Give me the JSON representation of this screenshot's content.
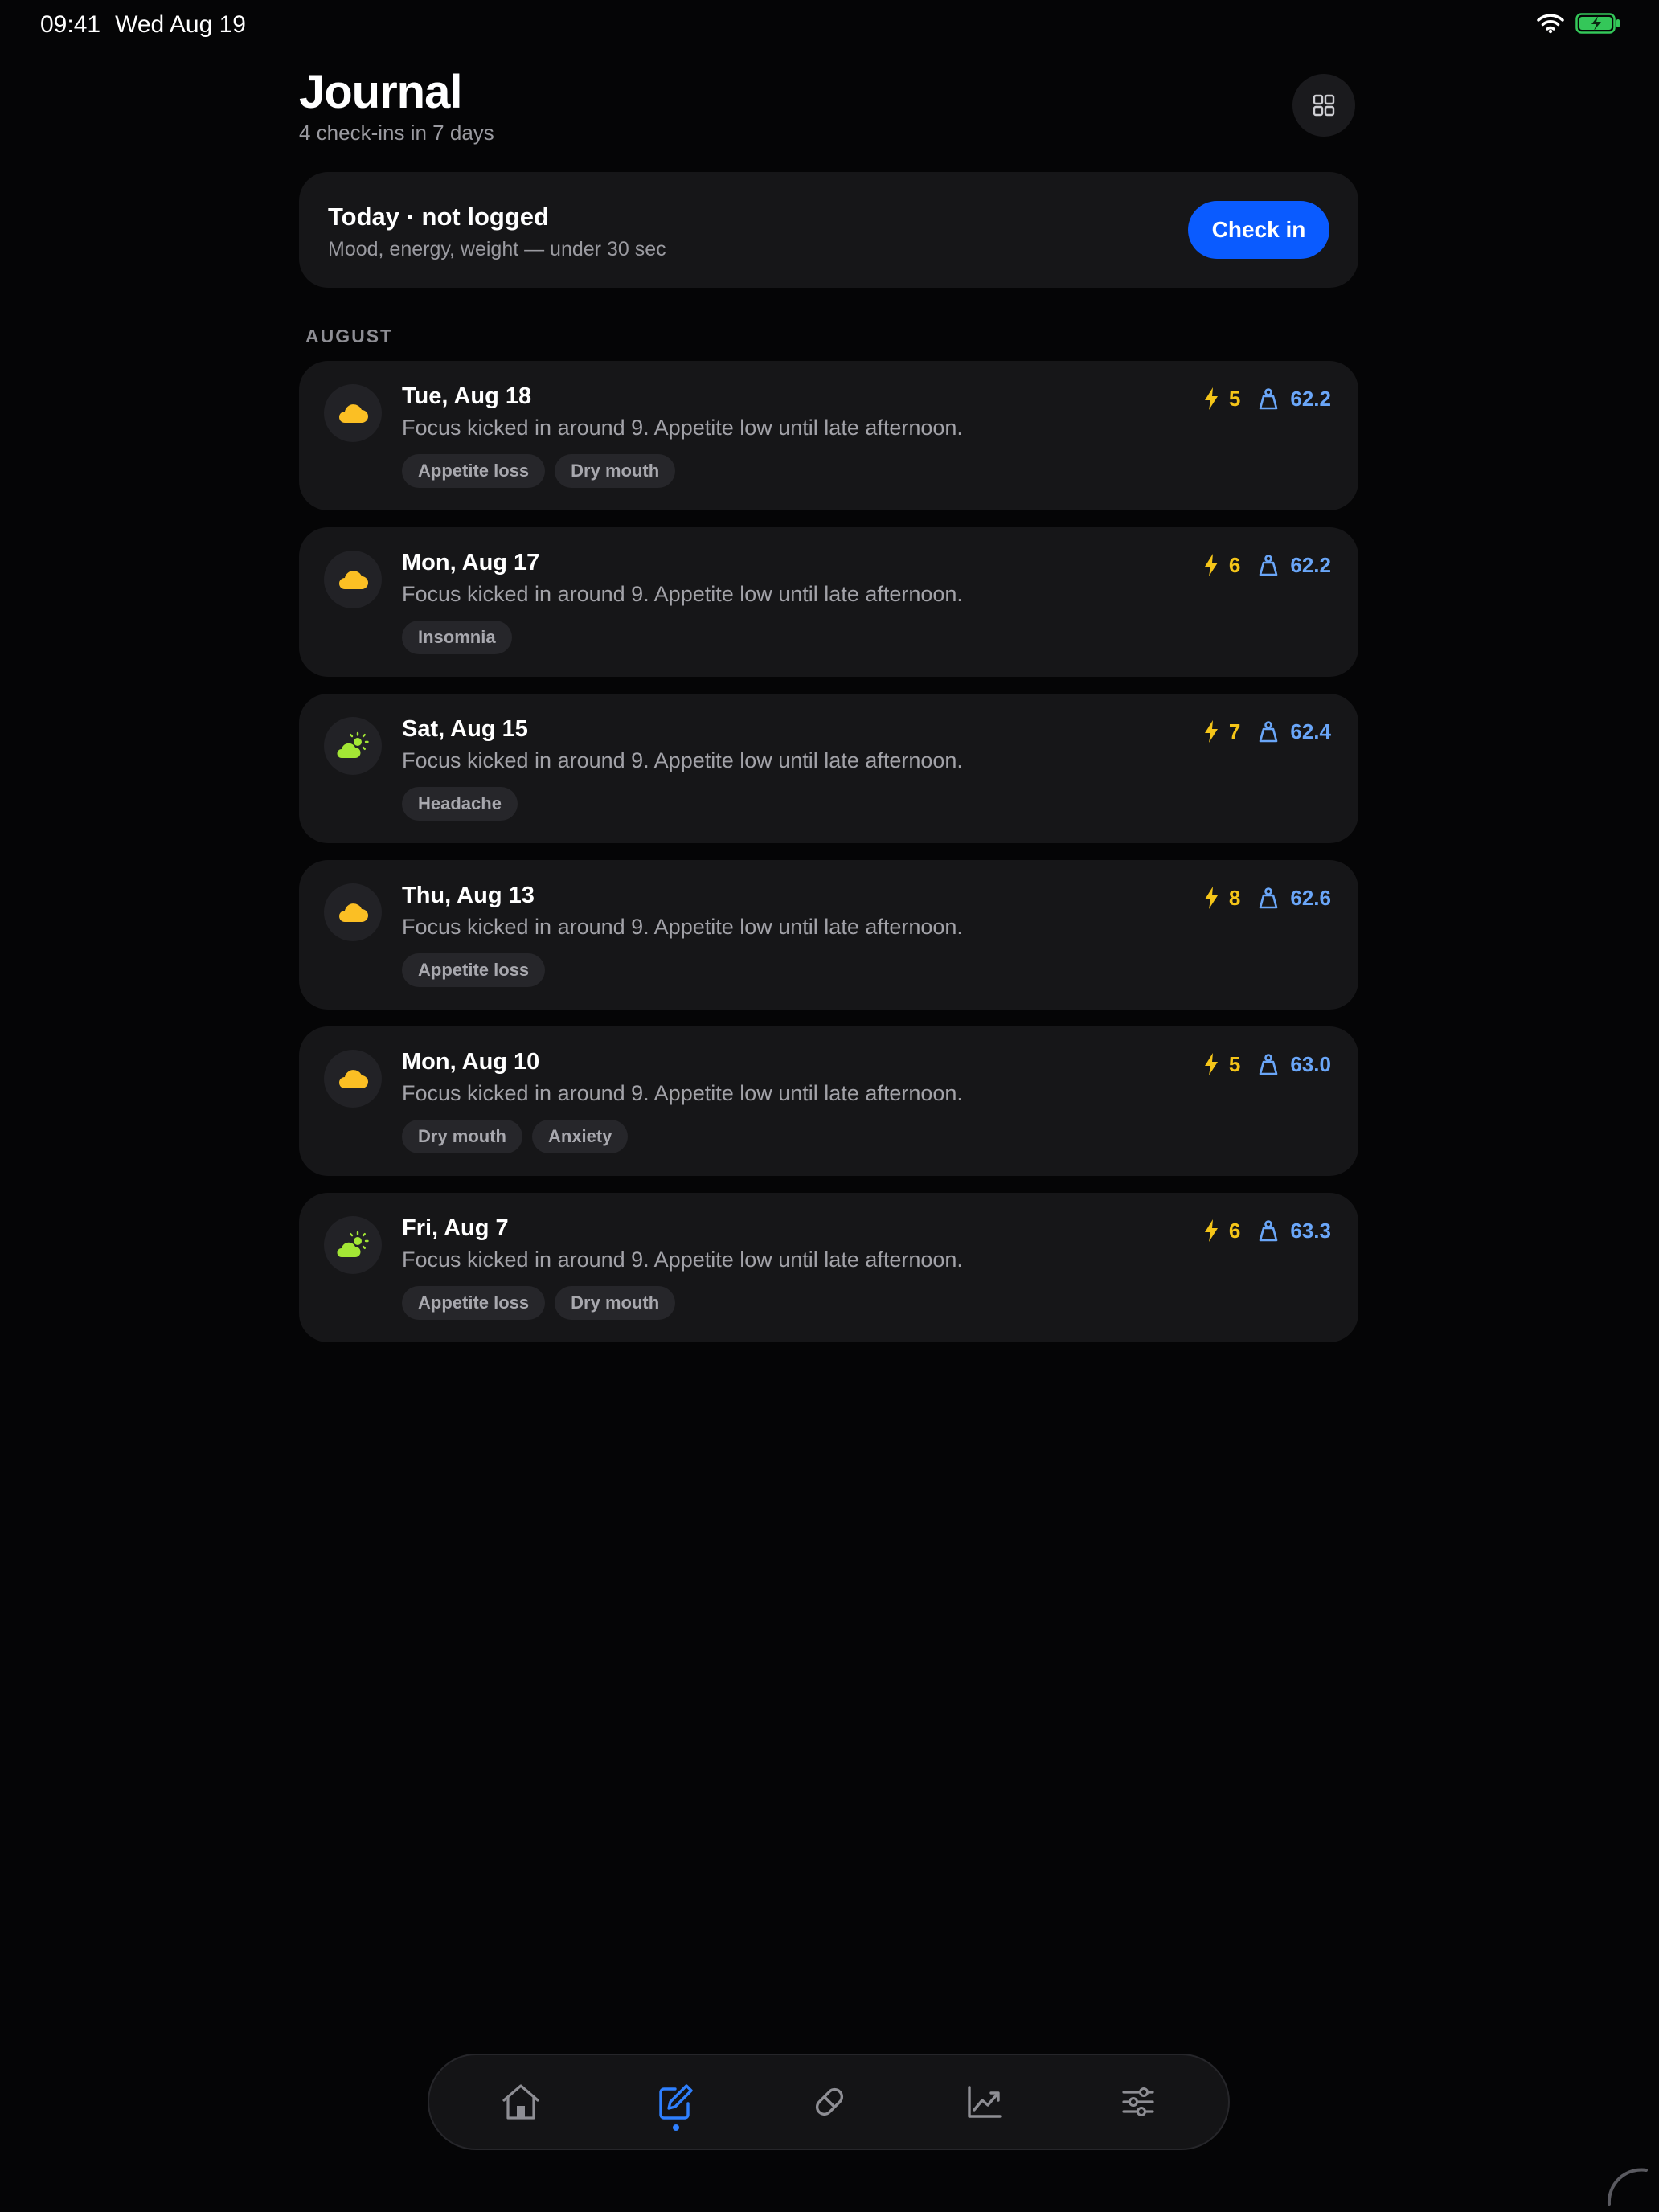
{
  "status_bar": {
    "time": "09:41",
    "date": "Wed Aug 19"
  },
  "header": {
    "title": "Journal",
    "subtitle": "4 check-ins in 7 days"
  },
  "today": {
    "title": "Today · not logged",
    "subtitle": "Mood, energy, weight — under 30 sec",
    "button_label": "Check in"
  },
  "section": {
    "label": "AUGUST"
  },
  "entries": [
    {
      "date": "Tue, Aug 18",
      "note": "Focus kicked in around 9. Appetite low until late afternoon.",
      "mood_icon": "cloud-icon",
      "energy": "5",
      "weight": "62.2",
      "tags": [
        "Appetite loss",
        "Dry mouth"
      ]
    },
    {
      "date": "Mon, Aug 17",
      "note": "Focus kicked in around 9. Appetite low until late afternoon.",
      "mood_icon": "cloud-icon",
      "energy": "6",
      "weight": "62.2",
      "tags": [
        "Insomnia"
      ]
    },
    {
      "date": "Sat, Aug 15",
      "note": "Focus kicked in around 9. Appetite low until late afternoon.",
      "mood_icon": "partly-sunny-icon",
      "energy": "7",
      "weight": "62.4",
      "tags": [
        "Headache"
      ]
    },
    {
      "date": "Thu, Aug 13",
      "note": "Focus kicked in around 9. Appetite low until late afternoon.",
      "mood_icon": "cloud-icon",
      "energy": "8",
      "weight": "62.6",
      "tags": [
        "Appetite loss"
      ]
    },
    {
      "date": "Mon, Aug 10",
      "note": "Focus kicked in around 9. Appetite low until late afternoon.",
      "mood_icon": "cloud-icon",
      "energy": "5",
      "weight": "63.0",
      "tags": [
        "Dry mouth",
        "Anxiety"
      ]
    },
    {
      "date": "Fri, Aug 7",
      "note": "Focus kicked in around 9. Appetite low until late afternoon.",
      "mood_icon": "partly-sunny-icon",
      "energy": "6",
      "weight": "63.3",
      "tags": [
        "Appetite loss",
        "Dry mouth"
      ]
    }
  ],
  "tab_bar": {
    "tabs": [
      {
        "icon": "home-icon",
        "active": false
      },
      {
        "icon": "journal-edit-icon",
        "active": true
      },
      {
        "icon": "pill-icon",
        "active": false
      },
      {
        "icon": "chart-icon",
        "active": false
      },
      {
        "icon": "sliders-icon",
        "active": false
      }
    ]
  },
  "colors": {
    "background": "#050506",
    "card": "#161618",
    "accent": "#0a5bff",
    "energy": "#f5c518",
    "weight": "#6aa6f8",
    "mood_cloud": "#fbbf24",
    "mood_partly_sunny": "#a3e635",
    "battery": "#34c759"
  }
}
